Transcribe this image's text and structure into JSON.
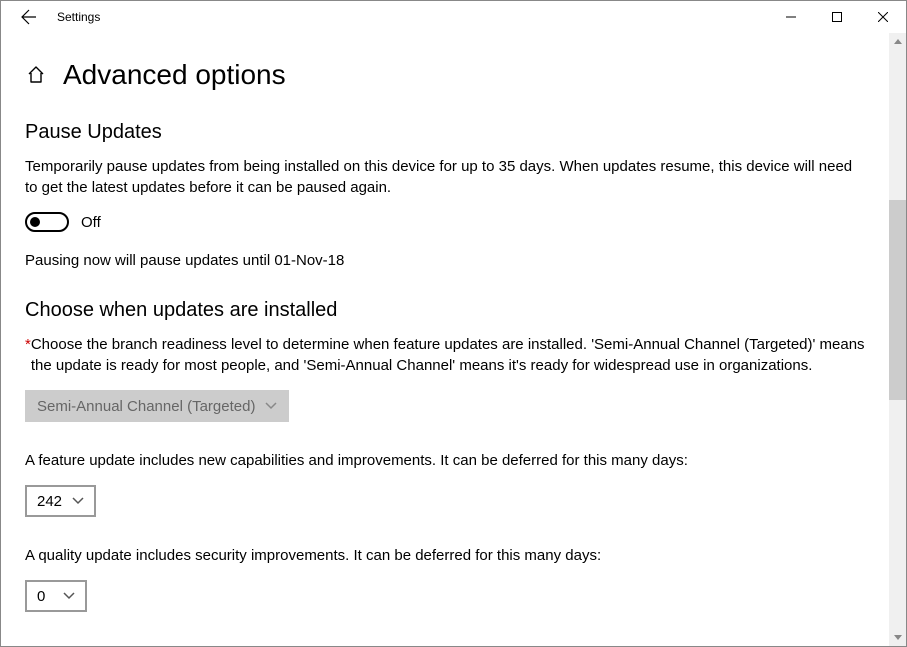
{
  "window": {
    "title": "Settings"
  },
  "page": {
    "title": "Advanced options"
  },
  "pause": {
    "heading": "Pause Updates",
    "description": "Temporarily pause updates from being installed on this device for up to 35 days. When updates resume, this device will need to get the latest updates before it can be paused again.",
    "toggle_state": "Off",
    "footer": "Pausing now will pause updates until 01-Nov-18"
  },
  "choose": {
    "heading": "Choose when updates are installed",
    "branch_text": "Choose the branch readiness level to determine when feature updates are installed. 'Semi-Annual Channel (Targeted)' means the update is ready for most people, and 'Semi-Annual Channel' means it's ready for widespread use in organizations.",
    "branch_value": "Semi-Annual Channel (Targeted)",
    "feature_text": "A feature update includes new capabilities and improvements. It can be deferred for this many days:",
    "feature_value": "242",
    "quality_text": "A quality update includes security improvements. It can be deferred for this many days:",
    "quality_value": "0"
  }
}
